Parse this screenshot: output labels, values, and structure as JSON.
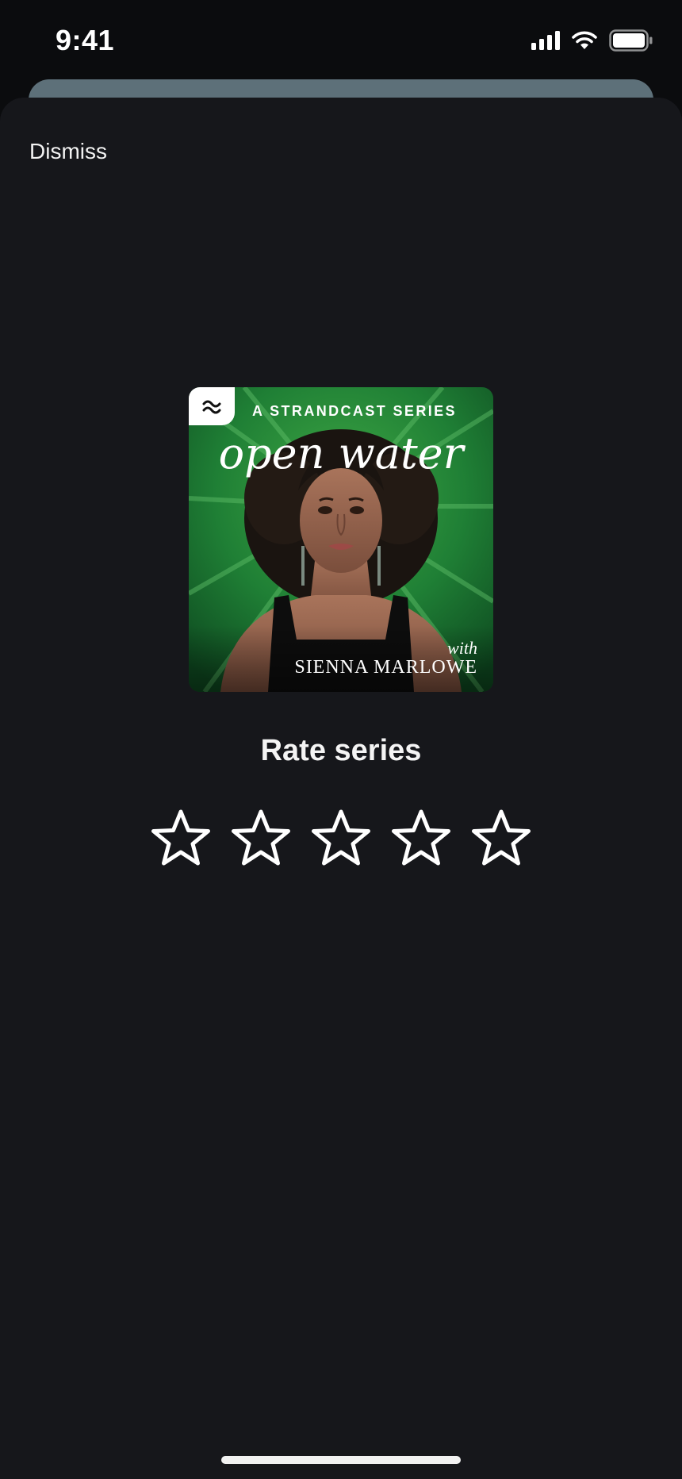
{
  "status_bar": {
    "time": "9:41",
    "icons": [
      "cellular-signal-icon",
      "wifi-icon",
      "battery-icon"
    ]
  },
  "sheet": {
    "dismiss_label": "Dismiss"
  },
  "artwork": {
    "series_label": "A STRANDCAST SERIES",
    "title": "open water",
    "with_label": "with",
    "host": "SIENNA MARLOWE",
    "badge_icon": "wave-logo-icon"
  },
  "rating": {
    "title": "Rate series",
    "max_stars": 5,
    "current_rating": 0,
    "star_icon": "star-outline-icon"
  },
  "colors": {
    "sheet_background": "#16171b",
    "back_card": "#5d7079",
    "text": "#f4f4f4"
  }
}
